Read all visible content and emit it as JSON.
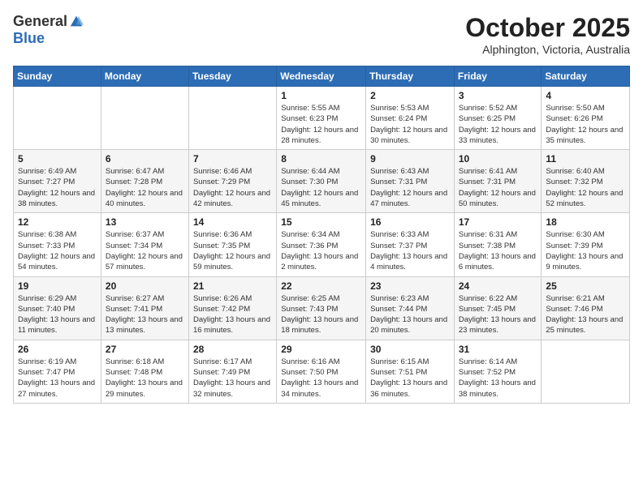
{
  "header": {
    "logo_general": "General",
    "logo_blue": "Blue",
    "month_year": "October 2025",
    "location": "Alphington, Victoria, Australia"
  },
  "weekdays": [
    "Sunday",
    "Monday",
    "Tuesday",
    "Wednesday",
    "Thursday",
    "Friday",
    "Saturday"
  ],
  "weeks": [
    [
      {
        "day": "",
        "info": ""
      },
      {
        "day": "",
        "info": ""
      },
      {
        "day": "",
        "info": ""
      },
      {
        "day": "1",
        "info": "Sunrise: 5:55 AM\nSunset: 6:23 PM\nDaylight: 12 hours\nand 28 minutes."
      },
      {
        "day": "2",
        "info": "Sunrise: 5:53 AM\nSunset: 6:24 PM\nDaylight: 12 hours\nand 30 minutes."
      },
      {
        "day": "3",
        "info": "Sunrise: 5:52 AM\nSunset: 6:25 PM\nDaylight: 12 hours\nand 33 minutes."
      },
      {
        "day": "4",
        "info": "Sunrise: 5:50 AM\nSunset: 6:26 PM\nDaylight: 12 hours\nand 35 minutes."
      }
    ],
    [
      {
        "day": "5",
        "info": "Sunrise: 6:49 AM\nSunset: 7:27 PM\nDaylight: 12 hours\nand 38 minutes."
      },
      {
        "day": "6",
        "info": "Sunrise: 6:47 AM\nSunset: 7:28 PM\nDaylight: 12 hours\nand 40 minutes."
      },
      {
        "day": "7",
        "info": "Sunrise: 6:46 AM\nSunset: 7:29 PM\nDaylight: 12 hours\nand 42 minutes."
      },
      {
        "day": "8",
        "info": "Sunrise: 6:44 AM\nSunset: 7:30 PM\nDaylight: 12 hours\nand 45 minutes."
      },
      {
        "day": "9",
        "info": "Sunrise: 6:43 AM\nSunset: 7:31 PM\nDaylight: 12 hours\nand 47 minutes."
      },
      {
        "day": "10",
        "info": "Sunrise: 6:41 AM\nSunset: 7:31 PM\nDaylight: 12 hours\nand 50 minutes."
      },
      {
        "day": "11",
        "info": "Sunrise: 6:40 AM\nSunset: 7:32 PM\nDaylight: 12 hours\nand 52 minutes."
      }
    ],
    [
      {
        "day": "12",
        "info": "Sunrise: 6:38 AM\nSunset: 7:33 PM\nDaylight: 12 hours\nand 54 minutes."
      },
      {
        "day": "13",
        "info": "Sunrise: 6:37 AM\nSunset: 7:34 PM\nDaylight: 12 hours\nand 57 minutes."
      },
      {
        "day": "14",
        "info": "Sunrise: 6:36 AM\nSunset: 7:35 PM\nDaylight: 12 hours\nand 59 minutes."
      },
      {
        "day": "15",
        "info": "Sunrise: 6:34 AM\nSunset: 7:36 PM\nDaylight: 13 hours\nand 2 minutes."
      },
      {
        "day": "16",
        "info": "Sunrise: 6:33 AM\nSunset: 7:37 PM\nDaylight: 13 hours\nand 4 minutes."
      },
      {
        "day": "17",
        "info": "Sunrise: 6:31 AM\nSunset: 7:38 PM\nDaylight: 13 hours\nand 6 minutes."
      },
      {
        "day": "18",
        "info": "Sunrise: 6:30 AM\nSunset: 7:39 PM\nDaylight: 13 hours\nand 9 minutes."
      }
    ],
    [
      {
        "day": "19",
        "info": "Sunrise: 6:29 AM\nSunset: 7:40 PM\nDaylight: 13 hours\nand 11 minutes."
      },
      {
        "day": "20",
        "info": "Sunrise: 6:27 AM\nSunset: 7:41 PM\nDaylight: 13 hours\nand 13 minutes."
      },
      {
        "day": "21",
        "info": "Sunrise: 6:26 AM\nSunset: 7:42 PM\nDaylight: 13 hours\nand 16 minutes."
      },
      {
        "day": "22",
        "info": "Sunrise: 6:25 AM\nSunset: 7:43 PM\nDaylight: 13 hours\nand 18 minutes."
      },
      {
        "day": "23",
        "info": "Sunrise: 6:23 AM\nSunset: 7:44 PM\nDaylight: 13 hours\nand 20 minutes."
      },
      {
        "day": "24",
        "info": "Sunrise: 6:22 AM\nSunset: 7:45 PM\nDaylight: 13 hours\nand 23 minutes."
      },
      {
        "day": "25",
        "info": "Sunrise: 6:21 AM\nSunset: 7:46 PM\nDaylight: 13 hours\nand 25 minutes."
      }
    ],
    [
      {
        "day": "26",
        "info": "Sunrise: 6:19 AM\nSunset: 7:47 PM\nDaylight: 13 hours\nand 27 minutes."
      },
      {
        "day": "27",
        "info": "Sunrise: 6:18 AM\nSunset: 7:48 PM\nDaylight: 13 hours\nand 29 minutes."
      },
      {
        "day": "28",
        "info": "Sunrise: 6:17 AM\nSunset: 7:49 PM\nDaylight: 13 hours\nand 32 minutes."
      },
      {
        "day": "29",
        "info": "Sunrise: 6:16 AM\nSunset: 7:50 PM\nDaylight: 13 hours\nand 34 minutes."
      },
      {
        "day": "30",
        "info": "Sunrise: 6:15 AM\nSunset: 7:51 PM\nDaylight: 13 hours\nand 36 minutes."
      },
      {
        "day": "31",
        "info": "Sunrise: 6:14 AM\nSunset: 7:52 PM\nDaylight: 13 hours\nand 38 minutes."
      },
      {
        "day": "",
        "info": ""
      }
    ]
  ]
}
